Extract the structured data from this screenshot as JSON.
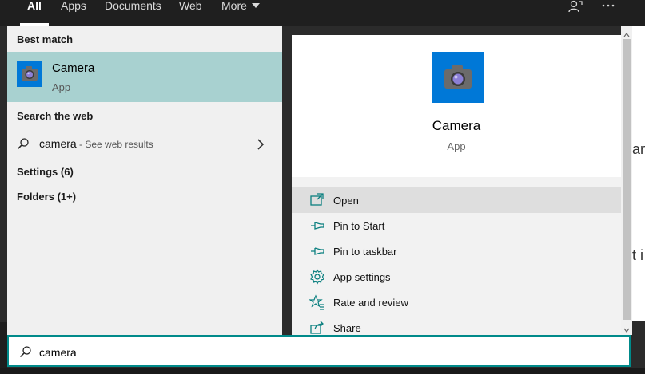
{
  "topbar": {
    "tabs": [
      {
        "label": "All",
        "active": true
      },
      {
        "label": "Apps"
      },
      {
        "label": "Documents"
      },
      {
        "label": "Web"
      },
      {
        "label": "More"
      }
    ],
    "icons": [
      "feedback-icon",
      "ellipsis-icon"
    ]
  },
  "results": {
    "best_match_label": "Best match",
    "best_match": {
      "title": "Camera",
      "subtitle": "App",
      "icon": "camera-icon"
    },
    "web_label": "Search the web",
    "web_query": "camera",
    "web_hint": " - See web results",
    "settings": "Settings (6)",
    "folders": "Folders (1+)"
  },
  "detail": {
    "title": "Camera",
    "subtitle": "App",
    "actions": [
      {
        "label": "Open",
        "icon": "open-icon"
      },
      {
        "label": "Pin to Start",
        "icon": "pin-icon"
      },
      {
        "label": "Pin to taskbar",
        "icon": "pin-icon"
      },
      {
        "label": "App settings",
        "icon": "gear-icon"
      },
      {
        "label": "Rate and review",
        "icon": "star-icon"
      },
      {
        "label": "Share",
        "icon": "share-icon"
      }
    ]
  },
  "background": {
    "peek_1": "an",
    "peek_2": "t i"
  },
  "search": {
    "value": "camera"
  },
  "colors": {
    "accent": "#0078d7",
    "selection": "#a8d1d0",
    "search_border": "#008a8a"
  }
}
